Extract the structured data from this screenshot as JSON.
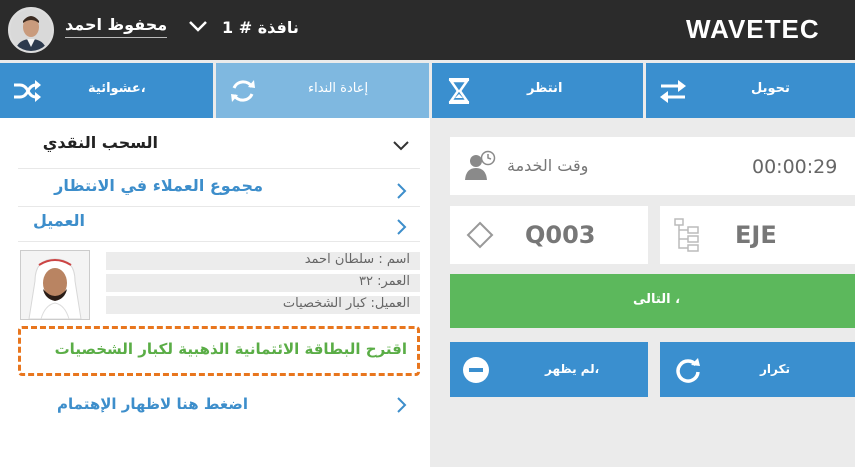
{
  "header": {
    "logo": "WAVETEC",
    "window_label": "نافذة # 1",
    "user_name": "محفوظ احمد"
  },
  "actions": {
    "transfer": "تحويل",
    "wait": "انتظر",
    "recall": "إعادة النداء",
    "random": "،عشوائية"
  },
  "left": {
    "cash_withdrawal": "السحب النقدي",
    "waiting_customers": "مجموع العملاء في الانتظار",
    "customer": "العميل",
    "name": "اسم : سلطان احمد",
    "age": "العمر: ٣٢",
    "segment": "العميل: كبار الشخصيات",
    "suggestion": "اقترح البطاقة الائتمانية الذهبية لكبار الشخصيات",
    "show_interest": "اضغط هنا لاظهار الإهتمام"
  },
  "right": {
    "service_time_label": "وقت الخدمة",
    "service_time_value": "00:00:29",
    "ticket_number": "Q003",
    "queue_code": "EJE",
    "next": "، التالى",
    "no_show": "،لم يظهر",
    "repeat": "تكرار"
  },
  "colors": {
    "topbar": "#2b2b2b",
    "action_blue": "#3a8fcf",
    "action_active": "#7fb8e0",
    "next_green": "#5cb85c",
    "link_blue": "#3d8ecb",
    "suggest_border": "#e8761e",
    "suggest_text": "#5aad46"
  }
}
